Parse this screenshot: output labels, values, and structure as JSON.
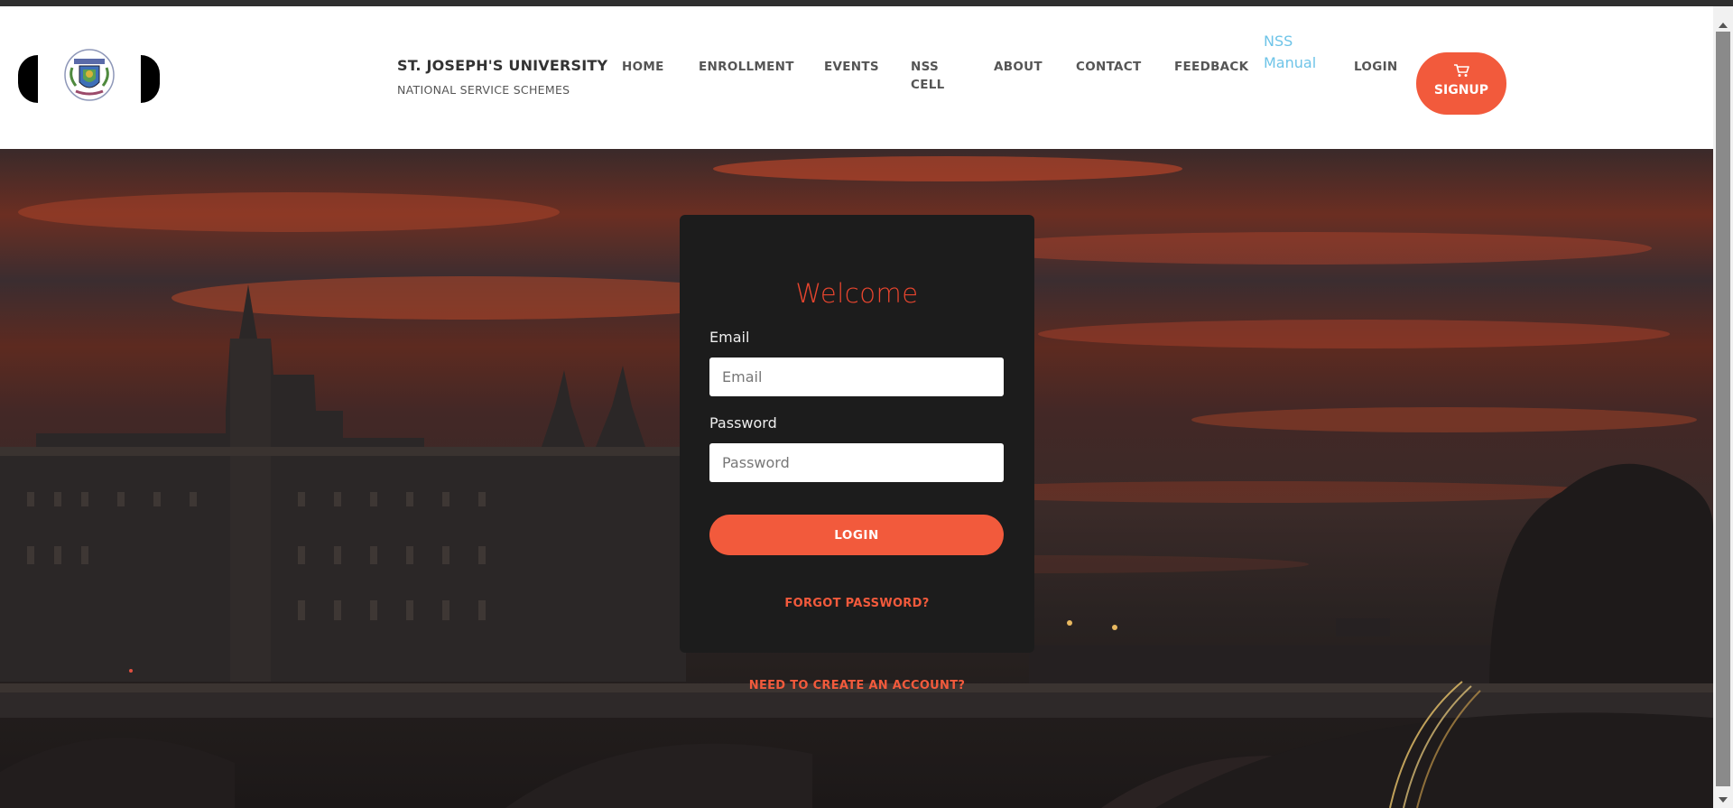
{
  "brand": {
    "title": "ST. JOSEPH'S UNIVERSITY",
    "subtitle": "NATIONAL SERVICE SCHEMES"
  },
  "nav": {
    "home": "HOME",
    "enrollment": "ENROLLMENT",
    "events": "EVENTS",
    "nss_cell_line1": "NSS",
    "nss_cell_line2": "CELL",
    "about": "ABOUT",
    "contact": "CONTACT",
    "feedback": "FEEDBACK",
    "nss_manual_line1": "NSS",
    "nss_manual_line2": "Manual",
    "login": "LOGIN",
    "signup": "SIGNUP"
  },
  "login_form": {
    "welcome": "Welcome",
    "email_label": "Email",
    "email_placeholder": "Email",
    "password_label": "Password",
    "password_placeholder": "Password",
    "login_button": "LOGIN",
    "forgot_password": "FORGOT PASSWORD?"
  },
  "create_account": "NEED TO CREATE AN ACCOUNT?",
  "colors": {
    "accent": "#f25a3c",
    "welcome": "#e8452e",
    "card": "#1c1c1c",
    "link_blue": "#6ec4e8"
  },
  "icons": {
    "signup": "cart-icon"
  }
}
